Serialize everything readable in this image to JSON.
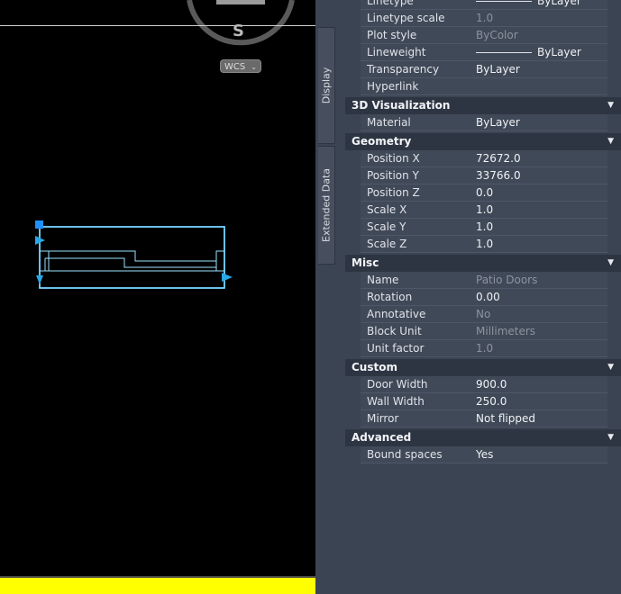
{
  "compass": {
    "direction": "S",
    "ucs_label": "WCS",
    "ucs_dropdown_icon": "chevron-down-icon"
  },
  "colors": {
    "canvas": "#000000",
    "status_bar": "#ffff00",
    "grip": "#1e90ff",
    "outline": "#62c8ef",
    "panel": "#3b4453"
  },
  "side_tabs": [
    "Display",
    "Extended Data"
  ],
  "properties": {
    "general_tail": [
      {
        "name": "Linetype",
        "value": "ByLayer",
        "swatch": true
      },
      {
        "name": "Linetype scale",
        "value": "1.0",
        "dim": true
      },
      {
        "name": "Plot style",
        "value": "ByColor",
        "dim": true
      },
      {
        "name": "Lineweight",
        "value": "ByLayer",
        "swatch": true
      },
      {
        "name": "Transparency",
        "value": "ByLayer"
      },
      {
        "name": "Hyperlink",
        "value": ""
      }
    ],
    "visualization": {
      "title": "3D Visualization",
      "rows": [
        {
          "name": "Material",
          "value": "ByLayer"
        }
      ]
    },
    "geometry": {
      "title": "Geometry",
      "rows": [
        {
          "name": "Position X",
          "value": "72672.0"
        },
        {
          "name": "Position Y",
          "value": "33766.0"
        },
        {
          "name": "Position Z",
          "value": "0.0"
        },
        {
          "name": "Scale X",
          "value": "1.0"
        },
        {
          "name": "Scale Y",
          "value": "1.0"
        },
        {
          "name": "Scale Z",
          "value": "1.0"
        }
      ]
    },
    "misc": {
      "title": "Misc",
      "rows": [
        {
          "name": "Name",
          "value": "Patio Doors",
          "dim": true
        },
        {
          "name": "Rotation",
          "value": "0.00"
        },
        {
          "name": "Annotative",
          "value": "No",
          "dim": true
        },
        {
          "name": "Block Unit",
          "value": "Millimeters",
          "dim": true
        },
        {
          "name": "Unit factor",
          "value": "1.0",
          "dim": true
        }
      ]
    },
    "custom": {
      "title": "Custom",
      "rows": [
        {
          "name": "Door Width",
          "value": "900.0"
        },
        {
          "name": "Wall Width",
          "value": "250.0"
        },
        {
          "name": "Mirror",
          "value": "Not flipped"
        }
      ]
    },
    "advanced": {
      "title": "Advanced",
      "rows": [
        {
          "name": "Bound spaces",
          "value": "Yes"
        }
      ]
    }
  }
}
